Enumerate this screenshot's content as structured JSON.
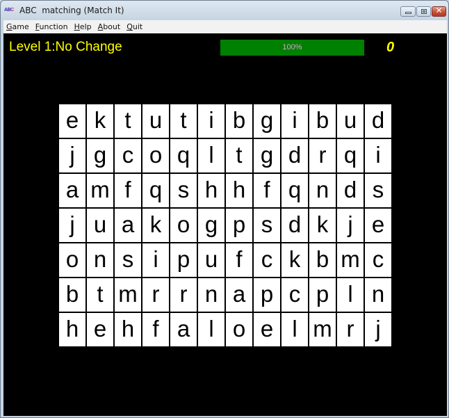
{
  "window": {
    "title": "ABC  matching (Match It)",
    "icon_text": [
      "A",
      "B",
      "C"
    ],
    "controls": {
      "minimize": "minimize-icon",
      "maximize": "maximize-icon",
      "close": "close-icon"
    }
  },
  "menu": {
    "items": [
      {
        "accel": "G",
        "rest": "ame",
        "label": "Game"
      },
      {
        "accel": "F",
        "rest": "unction",
        "label": "Function"
      },
      {
        "accel": "H",
        "rest": "elp",
        "label": "Help"
      },
      {
        "accel": "A",
        "rest": "bout",
        "label": "About"
      },
      {
        "accel": "Q",
        "rest": "uit",
        "label": "Quit"
      }
    ]
  },
  "status": {
    "level_label": "Level 1:No Change",
    "progress_text": "100%",
    "progress_fraction": 1.0,
    "score": "0"
  },
  "colors": {
    "level_text": "#ffff00",
    "score_text": "#ffff00",
    "progress_fill": "#008000",
    "progress_text": "#d8a0d8",
    "board_bg": "#000000",
    "cell_bg": "#ffffff"
  },
  "board": {
    "rows": 7,
    "cols": 12,
    "letters": [
      [
        "e",
        "k",
        "t",
        "u",
        "t",
        "i",
        "b",
        "g",
        "i",
        "b",
        "u",
        "d"
      ],
      [
        "j",
        "g",
        "c",
        "o",
        "q",
        "l",
        "t",
        "g",
        "d",
        "r",
        "q",
        "i"
      ],
      [
        "a",
        "m",
        "f",
        "q",
        "s",
        "h",
        "h",
        "f",
        "q",
        "n",
        "d",
        "s"
      ],
      [
        "j",
        "u",
        "a",
        "k",
        "o",
        "g",
        "p",
        "s",
        "d",
        "k",
        "j",
        "e"
      ],
      [
        "o",
        "n",
        "s",
        "i",
        "p",
        "u",
        "f",
        "c",
        "k",
        "b",
        "m",
        "c"
      ],
      [
        "b",
        "t",
        "m",
        "r",
        "r",
        "n",
        "a",
        "p",
        "c",
        "p",
        "l",
        "n"
      ],
      [
        "h",
        "e",
        "h",
        "f",
        "a",
        "l",
        "o",
        "e",
        "l",
        "m",
        "r",
        "j"
      ]
    ]
  }
}
